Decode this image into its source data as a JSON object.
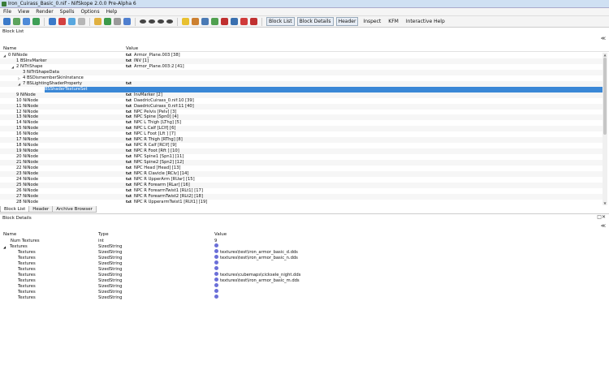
{
  "window": {
    "title": "Iron_Cuirass_Basic_0.nif - NifSkope 2.0.0 Pre-Alpha 6"
  },
  "menu": [
    "File",
    "View",
    "Render",
    "Spells",
    "Options",
    "Help"
  ],
  "toolbar": {
    "tabs": [
      {
        "label": "Block List",
        "active": true
      },
      {
        "label": "Block Details",
        "active": true
      },
      {
        "label": "Header",
        "active": true
      },
      {
        "label": "Inspect",
        "active": false
      },
      {
        "label": "KFM",
        "active": false
      },
      {
        "label": "Interactive Help",
        "active": false
      }
    ]
  },
  "block_list": {
    "title": "Block List",
    "columns": {
      "name": "Name",
      "value": "Value"
    },
    "rows": [
      {
        "label": "0 NiNode",
        "value": "Armor_Plane.003 [38]",
        "vtype": "txt",
        "indent": 0,
        "twisty": "open"
      },
      {
        "label": "1 BSInvMarker",
        "value": "INV [1]",
        "vtype": "txt",
        "indent": 1
      },
      {
        "label": "2 NiTriShape",
        "value": "Armor_Plane.003:2 [41]",
        "vtype": "txt",
        "indent": 1,
        "twisty": "open"
      },
      {
        "label": "3 NiTriShapeData",
        "value": "",
        "vtype": "",
        "indent": 2
      },
      {
        "label": "4 BSDismemberSkinInstance",
        "value": "",
        "vtype": "",
        "indent": 2,
        "twisty": "closed"
      },
      {
        "label": "7 BSLightingShaderProperty",
        "value": "",
        "vtype": "txt",
        "indent": 2,
        "twisty": "open"
      },
      {
        "label": "8 BSShaderTextureSet",
        "value": "",
        "vtype": "",
        "indent": 3,
        "selected": true
      },
      {
        "label": "9 NiNode",
        "value": "InvMarker [2]",
        "vtype": "txt",
        "indent": 1
      },
      {
        "label": "10 NiNode",
        "value": "DaedricCuirass_0.nif:10 [39]",
        "vtype": "txt",
        "indent": 1
      },
      {
        "label": "11 NiNode",
        "value": "DaedricCuirass_0.nif:11 [40]",
        "vtype": "txt",
        "indent": 1
      },
      {
        "label": "12 NiNode",
        "value": "NPC Pelvis [Pelv] [3]",
        "vtype": "txt",
        "indent": 1
      },
      {
        "label": "13 NiNode",
        "value": "NPC Spine [Spn0] [4]",
        "vtype": "txt",
        "indent": 1
      },
      {
        "label": "14 NiNode",
        "value": "NPC L Thigh [LThg] [5]",
        "vtype": "txt",
        "indent": 1
      },
      {
        "label": "15 NiNode",
        "value": "NPC L Calf [LClf] [6]",
        "vtype": "txt",
        "indent": 1
      },
      {
        "label": "16 NiNode",
        "value": "NPC L Foot [Lft ] [7]",
        "vtype": "txt",
        "indent": 1
      },
      {
        "label": "17 NiNode",
        "value": "NPC R Thigh [RThg] [8]",
        "vtype": "txt",
        "indent": 1
      },
      {
        "label": "18 NiNode",
        "value": "NPC R Calf [RClf] [9]",
        "vtype": "txt",
        "indent": 1
      },
      {
        "label": "19 NiNode",
        "value": "NPC R Foot [Rft ] [10]",
        "vtype": "txt",
        "indent": 1
      },
      {
        "label": "20 NiNode",
        "value": "NPC Spine1 [Spn1] [11]",
        "vtype": "txt",
        "indent": 1
      },
      {
        "label": "21 NiNode",
        "value": "NPC Spine2 [Spn2] [12]",
        "vtype": "txt",
        "indent": 1
      },
      {
        "label": "22 NiNode",
        "value": "NPC Head [Head] [13]",
        "vtype": "txt",
        "indent": 1
      },
      {
        "label": "23 NiNode",
        "value": "NPC R Clavicle [RClv] [14]",
        "vtype": "txt",
        "indent": 1
      },
      {
        "label": "24 NiNode",
        "value": "NPC R UpperArm [RUar] [15]",
        "vtype": "txt",
        "indent": 1
      },
      {
        "label": "25 NiNode",
        "value": "NPC R Forearm [RLar] [16]",
        "vtype": "txt",
        "indent": 1
      },
      {
        "label": "26 NiNode",
        "value": "NPC R ForearmTwist1 [RLt1] [17]",
        "vtype": "txt",
        "indent": 1
      },
      {
        "label": "27 NiNode",
        "value": "NPC R ForearmTwist2 [RLt2] [18]",
        "vtype": "txt",
        "indent": 1
      },
      {
        "label": "28 NiNode",
        "value": "NPC R UpperarmTwist1 [RUt1] [19]",
        "vtype": "txt",
        "indent": 1
      }
    ],
    "tabs": [
      {
        "label": "Block List",
        "active": true
      },
      {
        "label": "Header",
        "active": false
      },
      {
        "label": "Archive Browser",
        "active": false
      }
    ]
  },
  "block_details": {
    "title": "Block Details",
    "columns": {
      "name": "Name",
      "type": "Type",
      "value": "Value"
    },
    "rows": [
      {
        "name": "Num Textures",
        "type": "int",
        "value": "9",
        "icon": false,
        "indent": 1
      },
      {
        "name": "Textures",
        "type": "SizedString",
        "value": "",
        "icon": true,
        "indent": 0,
        "twisty": "open"
      },
      {
        "name": "Textures",
        "type": "SizedString",
        "value": "textures\\test\\iron_armor_basic_d.dds",
        "icon": true,
        "indent": 2
      },
      {
        "name": "Textures",
        "type": "SizedString",
        "value": "textures\\test\\iron_armor_basic_n.dds",
        "icon": true,
        "indent": 2
      },
      {
        "name": "Textures",
        "type": "SizedString",
        "value": "",
        "icon": true,
        "indent": 2
      },
      {
        "name": "Textures",
        "type": "SizedString",
        "value": "",
        "icon": true,
        "indent": 2
      },
      {
        "name": "Textures",
        "type": "SizedString",
        "value": "textures\\cubemaps\\cicksele_night.dds",
        "icon": true,
        "indent": 2
      },
      {
        "name": "Textures",
        "type": "SizedString",
        "value": "textures\\test\\iron_armor_basic_m.dds",
        "icon": true,
        "indent": 2
      },
      {
        "name": "Textures",
        "type": "SizedString",
        "value": "",
        "icon": true,
        "indent": 2
      },
      {
        "name": "Textures",
        "type": "SizedString",
        "value": "",
        "icon": true,
        "indent": 2
      },
      {
        "name": "Textures",
        "type": "SizedString",
        "value": "",
        "icon": true,
        "indent": 2
      }
    ]
  },
  "icons": {
    "toolbar": [
      "open-icon",
      "save-icon",
      "undo-icon",
      "redo-icon",
      "load-view-icon",
      "save-view-icon",
      "select-icon",
      "globe-icon",
      "texture-icon",
      "shape-icon",
      "grid-icon",
      "flip-icon",
      "front-view-icon",
      "side-view-icon",
      "top-view-icon",
      "eye-icon",
      "lightbulb-icon",
      "color-icon",
      "axes-icon",
      "nodes-icon",
      "constraints-icon",
      "markers-icon",
      "pin-icon",
      "block-icon"
    ],
    "colors": [
      "#3b7ac9",
      "#5ca35c",
      "#4e8ad8",
      "#3e9f56",
      "#3b7ac9",
      "#d34040",
      "#58a7df",
      "#b6b6b6",
      "#e0b040",
      "#3c9a4a",
      "#9a9a9a",
      "#4f7fcf",
      "#444444",
      "#444444",
      "#444444",
      "#444444",
      "#e8c030",
      "#cc8030",
      "#4a7ab5",
      "#50a050",
      "#c03030",
      "#3a70b0",
      "#d03b3b",
      "#c03030"
    ]
  }
}
